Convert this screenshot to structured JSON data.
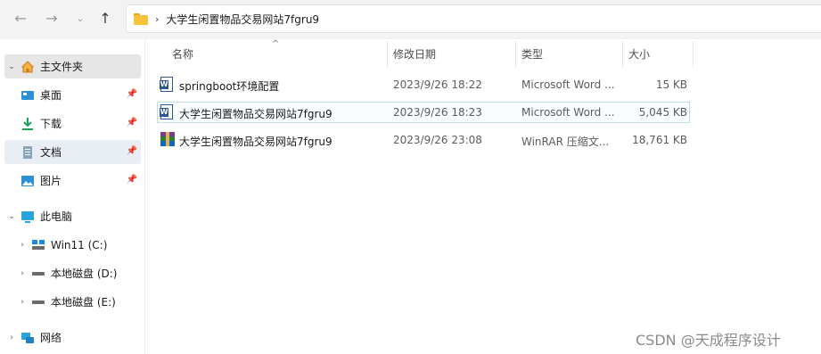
{
  "toolbar": {
    "back_icon": "arrow-left-icon",
    "forward_icon": "arrow-right-icon",
    "recent_icon": "chevron-down-icon",
    "up_icon": "arrow-up-icon"
  },
  "address": {
    "folder_icon": "folder-icon",
    "separator": "›",
    "current_folder": "大学生闲置物品交易网站7fgru9"
  },
  "sidebar": {
    "home": {
      "label": "主文件夹",
      "icon": "home-icon",
      "expanded": true
    },
    "quick": [
      {
        "label": "桌面",
        "icon": "desktop-icon",
        "pinned": true
      },
      {
        "label": "下载",
        "icon": "download-icon",
        "pinned": true
      },
      {
        "label": "文档",
        "icon": "documents-icon",
        "pinned": true
      },
      {
        "label": "图片",
        "icon": "pictures-icon",
        "pinned": true
      }
    ],
    "this_pc": {
      "label": "此电脑",
      "icon": "monitor-icon",
      "expanded": true
    },
    "drives": [
      {
        "label": "Win11 (C:)",
        "icon": "windows-drive-icon"
      },
      {
        "label": "本地磁盘 (D:)",
        "icon": "drive-icon"
      },
      {
        "label": "本地磁盘 (E:)",
        "icon": "drive-icon"
      }
    ],
    "network": {
      "label": "网络",
      "icon": "network-icon"
    }
  },
  "columns": {
    "name": "名称",
    "modified": "修改日期",
    "type": "类型",
    "size": "大小"
  },
  "files": [
    {
      "name": "springboot环境配置",
      "modified": "2023/9/26 18:22",
      "type": "Microsoft Word ...",
      "size": "15 KB",
      "icon": "word-document-icon"
    },
    {
      "name": "大学生闲置物品交易网站7fgru9",
      "modified": "2023/9/26 18:23",
      "type": "Microsoft Word ...",
      "size": "5,045 KB",
      "icon": "word-document-icon"
    },
    {
      "name": "大学生闲置物品交易网站7fgru9",
      "modified": "2023/9/26 23:08",
      "type": "WinRAR 压缩文...",
      "size": "18,761 KB",
      "icon": "winrar-archive-icon"
    }
  ],
  "watermark": "CSDN @天成程序设计",
  "colors": {
    "accent": "#0067c0",
    "folder": "#f8c33b",
    "selection_border": "#bfdde7"
  }
}
